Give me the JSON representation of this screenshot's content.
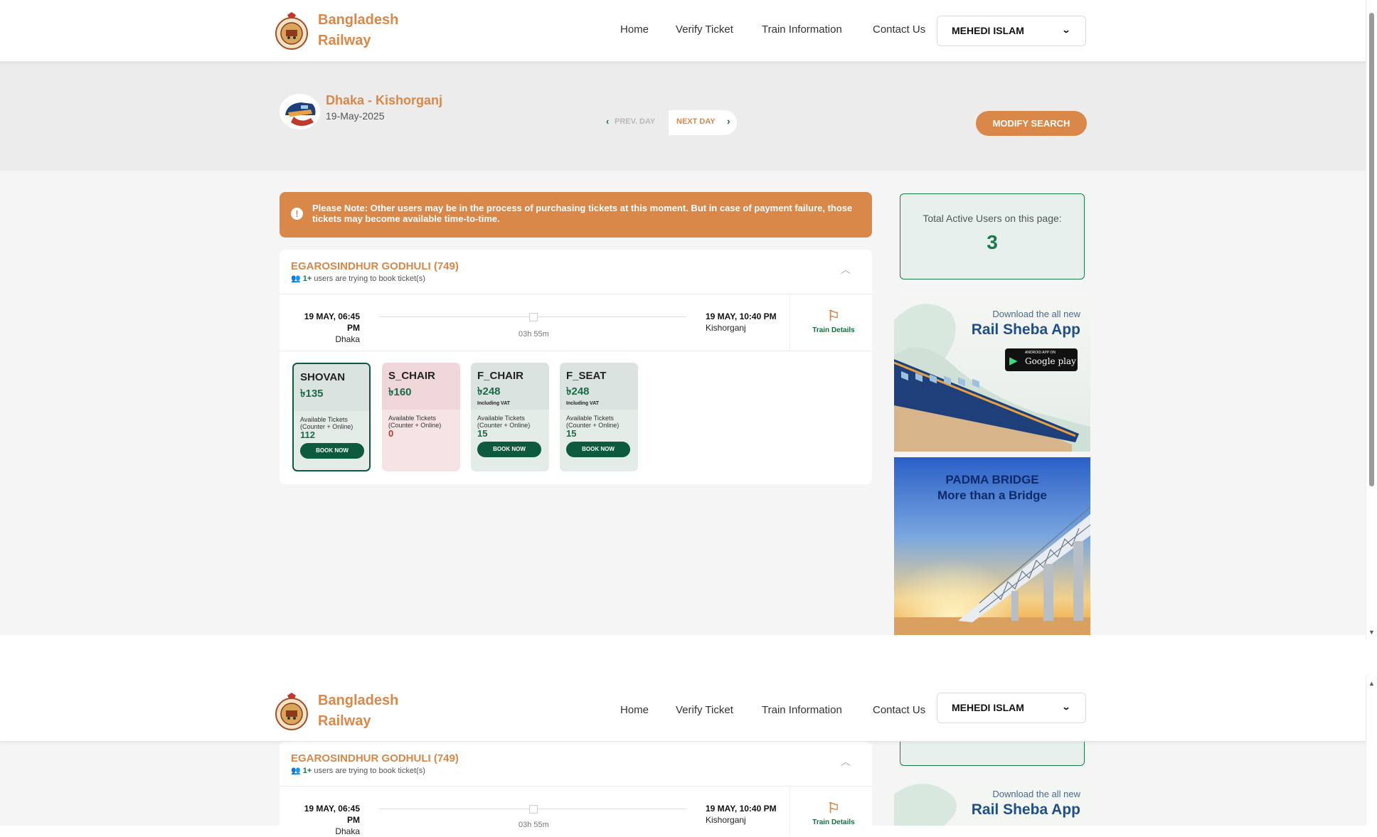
{
  "header": {
    "brand": "Bangladesh Railway",
    "nav": [
      "Home",
      "Verify Ticket",
      "Train Information",
      "Contact Us"
    ],
    "user": "MEHEDI ISLAM"
  },
  "journey": {
    "route": "Dhaka - Kishorganj",
    "date": "19-May-2025",
    "prev_day": "PREV. DAY",
    "next_day": "NEXT DAY",
    "modify": "MODIFY SEARCH"
  },
  "notice": "Please Note: Other users may be in the process of purchasing tickets at this moment. But in case of payment failure, those tickets may become available time-to-time.",
  "train": {
    "name": "EGAROSINDHUR GODHULI (749)",
    "users_count": "1+",
    "users_text": "users are trying to book ticket(s)",
    "departure_time": "19 MAY, 06:45 PM",
    "departure_station": "Dhaka",
    "arrival_time": "19 MAY, 10:40 PM",
    "arrival_station": "Kishorganj",
    "duration": "03h 55m",
    "details": "Train Details"
  },
  "seats": [
    {
      "class": "SHOVAN",
      "price": "৳135",
      "vat": "",
      "avail_label": "Available Tickets (Counter + Online)",
      "count": "112",
      "book": "BOOK NOW",
      "state": "selected"
    },
    {
      "class": "S_CHAIR",
      "price": "৳160",
      "vat": "",
      "avail_label": "Available Tickets (Counter + Online)",
      "count": "0",
      "book": "",
      "state": "unavailable"
    },
    {
      "class": "F_CHAIR",
      "price": "৳248",
      "vat": "Including VAT",
      "avail_label": "Available Tickets (Counter + Online)",
      "count": "15",
      "book": "BOOK NOW",
      "state": "normal"
    },
    {
      "class": "F_SEAT",
      "price": "৳248",
      "vat": "Including VAT",
      "avail_label": "Available Tickets (Counter + Online)",
      "count": "15",
      "book": "BOOK NOW",
      "state": "normal"
    }
  ],
  "active_users": {
    "label": "Total Active Users on this page:",
    "count": "3"
  },
  "app_ad": {
    "download": "Download the all new",
    "title": "Rail Sheba App",
    "store": "Google play",
    "store_small": "ANDROID APP ON"
  },
  "bridge_ad": {
    "line1": "PADMA BRIDGE",
    "line2": "More than a Bridge"
  },
  "colors": {
    "accent": "#d9884a",
    "green": "#1a6b45",
    "band": "#ececec"
  },
  "icons": [
    "railway-logo-icon",
    "chevron-down-icon",
    "chevron-left-icon",
    "chevron-right-icon",
    "exclamation-icon",
    "users-icon",
    "chevron-up-icon",
    "signpost-icon",
    "google-play-icon"
  ]
}
